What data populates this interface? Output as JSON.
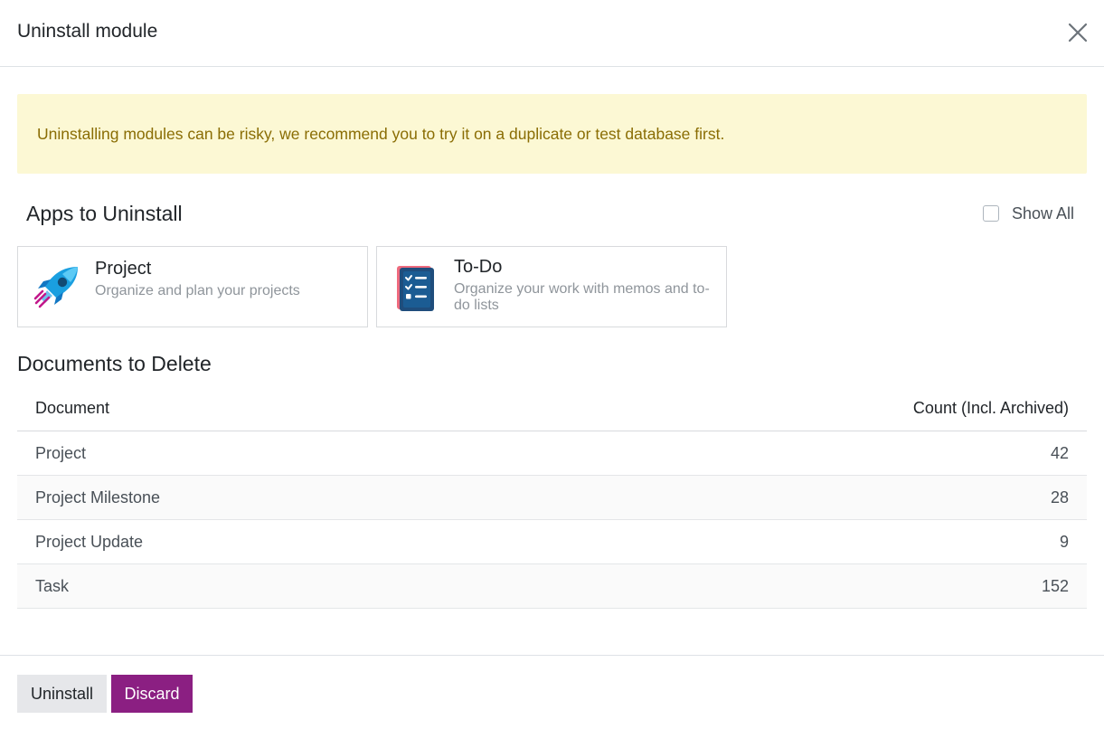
{
  "dialog": {
    "title": "Uninstall module",
    "close_icon": "close-icon"
  },
  "alert": {
    "text": "Uninstalling modules can be risky, we recommend you to try it on a duplicate or test database first.",
    "background": "#fcf8d4",
    "color": "#8a6d04"
  },
  "apps_section": {
    "title": "Apps to Uninstall",
    "show_all_label": "Show All",
    "show_all_checked": false,
    "apps": [
      {
        "name": "Project",
        "summary": "Organize and plan your projects",
        "icon": "rocket-icon"
      },
      {
        "name": "To-Do",
        "summary": "Organize your work with memos and to-do lists",
        "icon": "checklist-icon"
      }
    ]
  },
  "documents_section": {
    "title": "Documents to Delete",
    "columns": [
      "Document",
      "Count (Incl. Archived)"
    ],
    "rows": [
      {
        "document": "Project",
        "count": "42"
      },
      {
        "document": "Project Milestone",
        "count": "28"
      },
      {
        "document": "Project Update",
        "count": "9"
      },
      {
        "document": "Task",
        "count": "152"
      }
    ]
  },
  "footer": {
    "uninstall_label": "Uninstall",
    "discard_label": "Discard",
    "primary_color": "#8b1f82"
  }
}
